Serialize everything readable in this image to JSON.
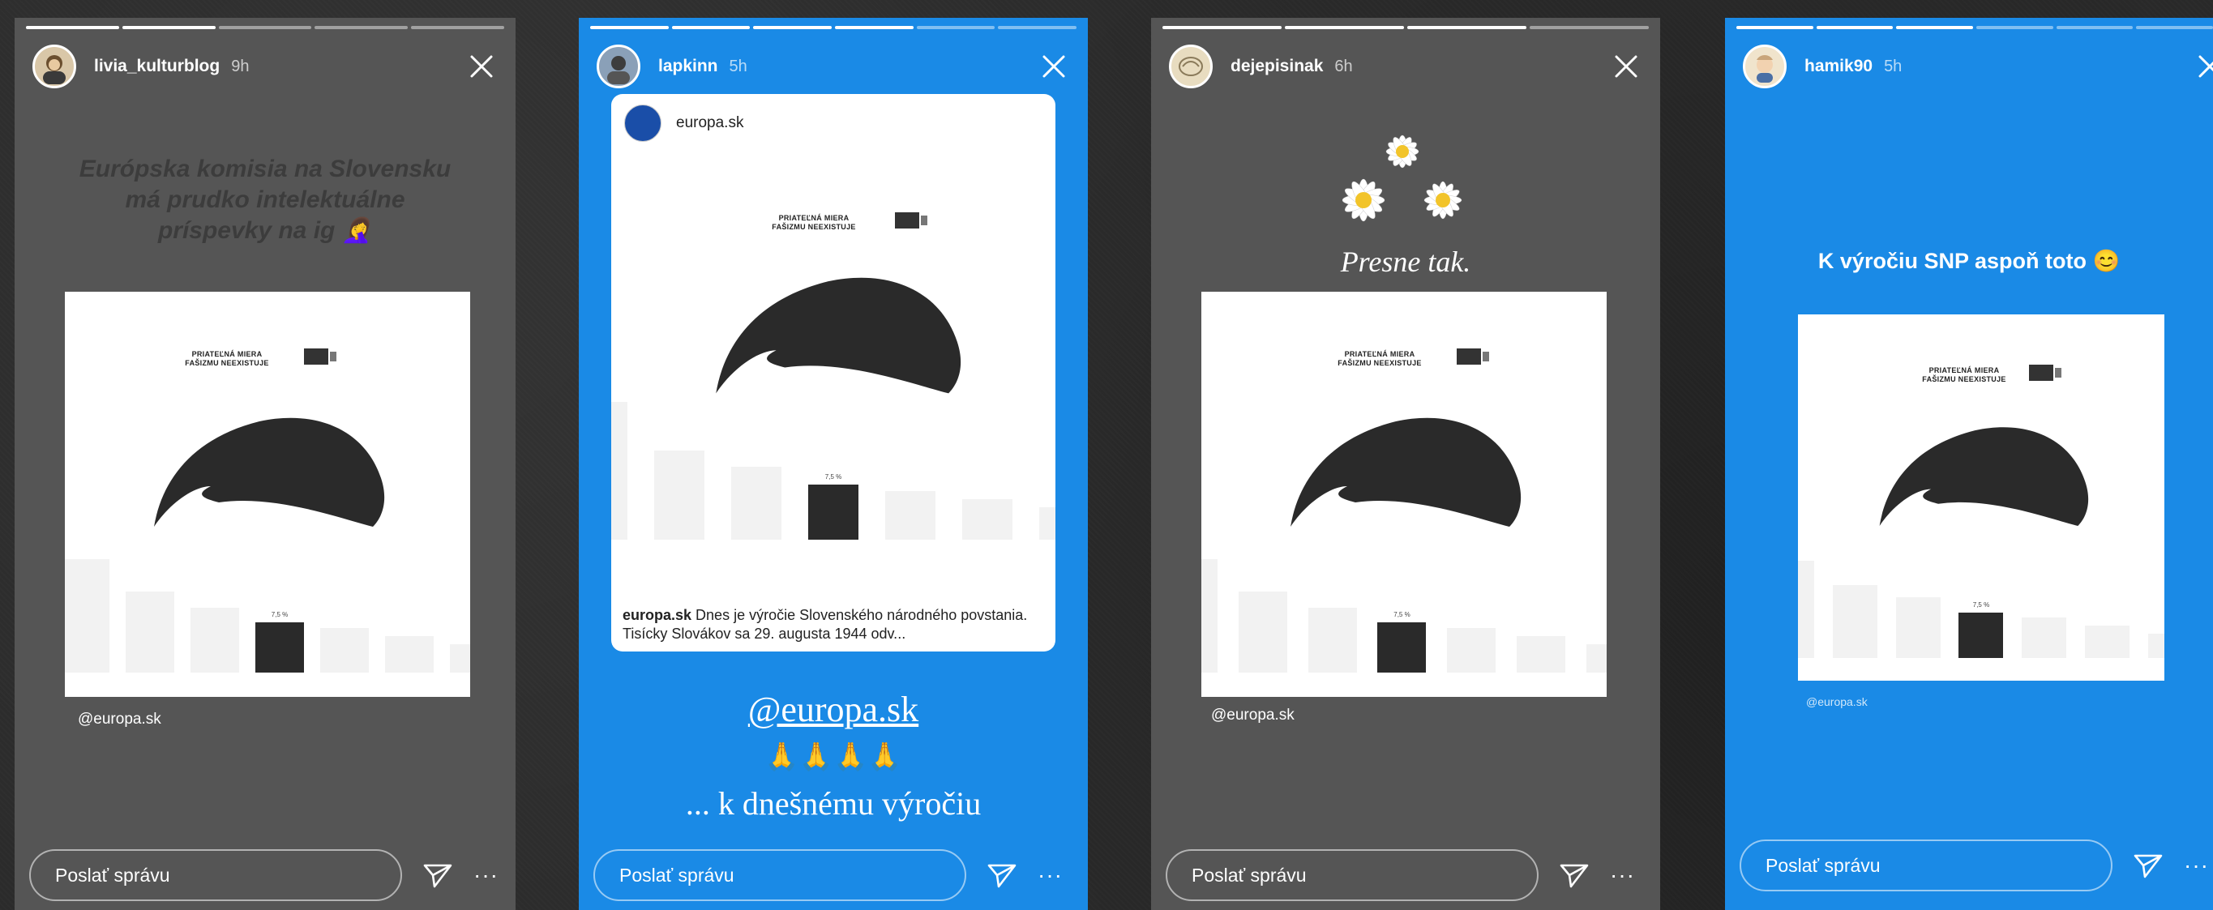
{
  "stories": [
    {
      "username": "livia_kulturblog",
      "age": "9h",
      "caption": [
        "Európska komisia na Slovensku",
        "má prudko intelektuálne",
        "príspevky na ig 🤦‍♀️"
      ],
      "poster_text": [
        "PRIATEĽNÁ MIERA",
        "FAŠIZMU NEEXISTUJE"
      ],
      "bar_label": "7,5 %",
      "credit": "@europa.sk",
      "message_placeholder": "Poslať správu",
      "more": "···"
    },
    {
      "username": "lapkinn",
      "age": "5h",
      "embed_account": "europa.sk",
      "poster_text": [
        "PRIATEĽNÁ MIERA",
        "FAŠIZMU NEEXISTUJE"
      ],
      "bar_label": "7,5 %",
      "embed_caption_user": "europa.sk",
      "embed_caption_text": " Dnes je výročie Slovenského národného povstania. Tisícky Slovákov sa 29. augusta 1944 odv...",
      "mention": "@europa.sk",
      "emoji_line": "🙏🙏🙏🙏",
      "text_line": "... k dnešnému výročiu",
      "message_placeholder": "Poslať správu",
      "more": "···"
    },
    {
      "username": "dejepisinak",
      "age": "6h",
      "caption": "Presne tak.",
      "poster_text": [
        "PRIATEĽNÁ MIERA",
        "FAŠIZMU NEEXISTUJE"
      ],
      "bar_label": "7,5 %",
      "credit": "@europa.sk",
      "message_placeholder": "Poslať správu",
      "more": "···"
    },
    {
      "username": "hamik90",
      "age": "5h",
      "caption": "K výročiu SNP aspoň toto 😊",
      "poster_text": [
        "PRIATEĽNÁ MIERA",
        "FAŠIZMU NEEXISTUJE"
      ],
      "bar_label": "7,5 %",
      "credit": "@europa.sk",
      "message_placeholder": "Poslať správu",
      "more": "···"
    }
  ],
  "colors": {
    "gray_story": "#555555",
    "blue_story": "#1a8ae6"
  }
}
